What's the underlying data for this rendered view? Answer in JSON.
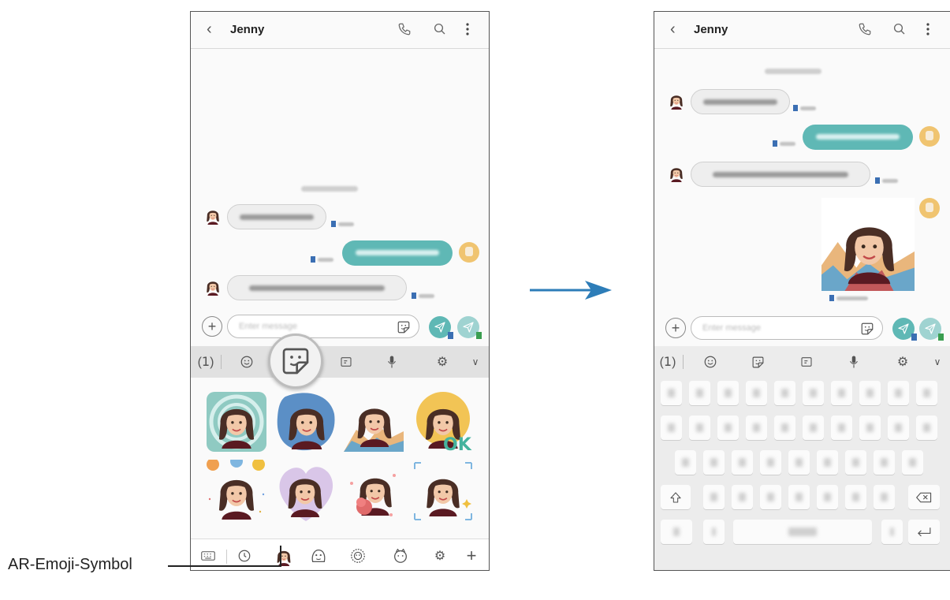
{
  "left_screen": {
    "contact_name": "Jenny",
    "input_placeholder": "Enter message",
    "keyboard_toolbar": [
      "voice-keyboard-icon",
      "emoji-icon",
      "sticker-icon",
      "gif-icon",
      "mic-icon",
      "settings-icon",
      "chevron-down-icon"
    ],
    "bottom_tabs": [
      "keyboard-icon",
      "recent-icon",
      "ar-emoji-icon",
      "character-sticker-icon",
      "sticker-pack-icon",
      "sticker-pack-icon",
      "settings-icon",
      "add-icon"
    ]
  },
  "right_screen": {
    "contact_name": "Jenny",
    "input_placeholder": "Enter message",
    "keyboard_toolbar": [
      "voice-keyboard-icon",
      "emoji-icon",
      "sticker-icon",
      "gif-icon",
      "mic-icon",
      "settings-icon",
      "chevron-down-icon"
    ]
  },
  "caption": "AR-Emoji-Symbol",
  "colors": {
    "accent_teal": "#5fb8b5",
    "sim_badge_blue": "#3b6fb3",
    "sim_badge_green": "#3a9e50",
    "user_avatar": "#f0c470",
    "arrow": "#2d7db8"
  }
}
